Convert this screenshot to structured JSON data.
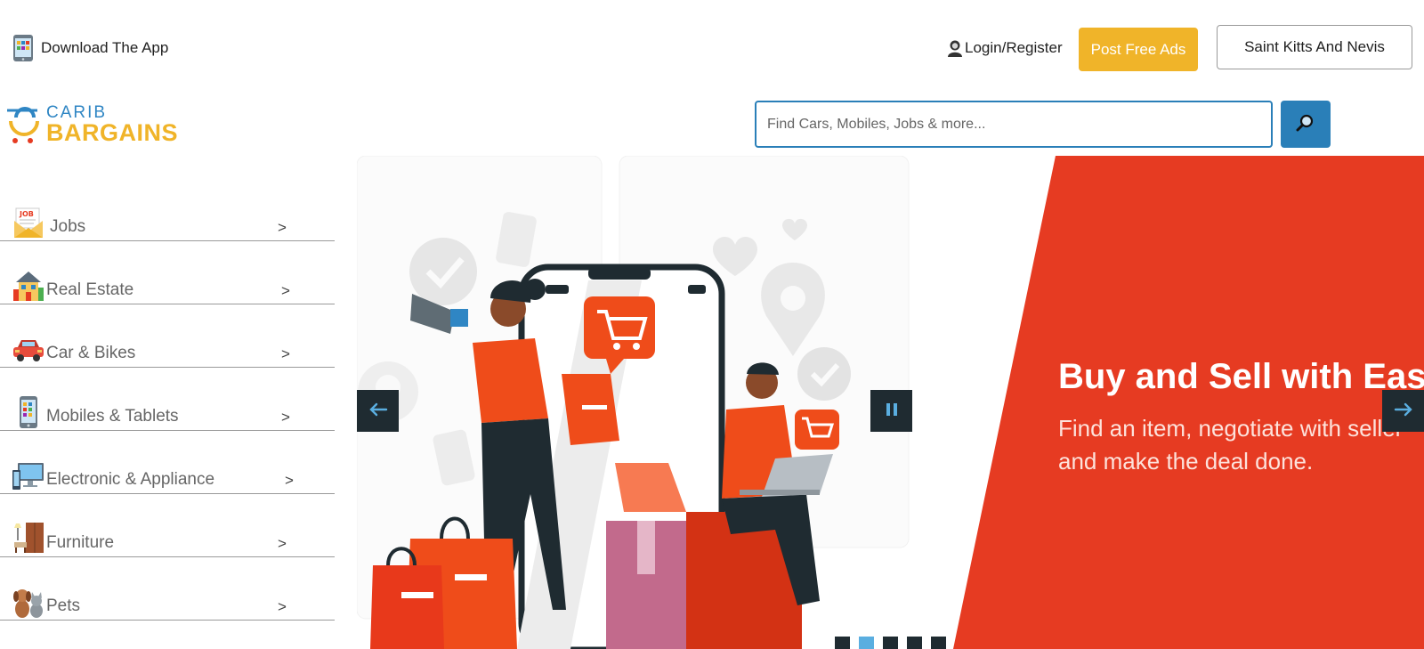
{
  "topbar": {
    "download_label": "Download The App",
    "login_label": "Login/Register",
    "post_ad_label": "Post Free Ads",
    "country_label": "Saint Kitts And Nevis"
  },
  "logo": {
    "line1": "CARIB",
    "line2": "BARGAINS"
  },
  "search": {
    "placeholder": "Find Cars, Mobiles, Jobs & more...",
    "icon": "search-icon"
  },
  "categories": [
    {
      "label": "Jobs",
      "arrow": ">",
      "icon": "job-envelope-icon"
    },
    {
      "label": "Real Estate",
      "arrow": ">",
      "icon": "house-icon"
    },
    {
      "label": "Car & Bikes",
      "arrow": ">",
      "icon": "car-icon"
    },
    {
      "label": "Mobiles & Tablets",
      "arrow": ">",
      "icon": "smartphone-icon"
    },
    {
      "label": "Electronic & Appliance",
      "arrow": ">",
      "icon": "computer-icon"
    },
    {
      "label": "Furniture",
      "arrow": ">",
      "icon": "furniture-icon"
    },
    {
      "label": "Pets",
      "arrow": ">",
      "icon": "pets-icon"
    }
  ],
  "slider": {
    "title": "Buy and Sell with Ease",
    "subtitle": "Find an item, negotiate with seller and make the deal done.",
    "slide_count": 5,
    "active_slide": 2
  },
  "colors": {
    "accent_blue": "#2a7fb8",
    "accent_yellow": "#f0b429",
    "banner_red": "#e63b22",
    "nav_dark": "#1f2b31"
  }
}
